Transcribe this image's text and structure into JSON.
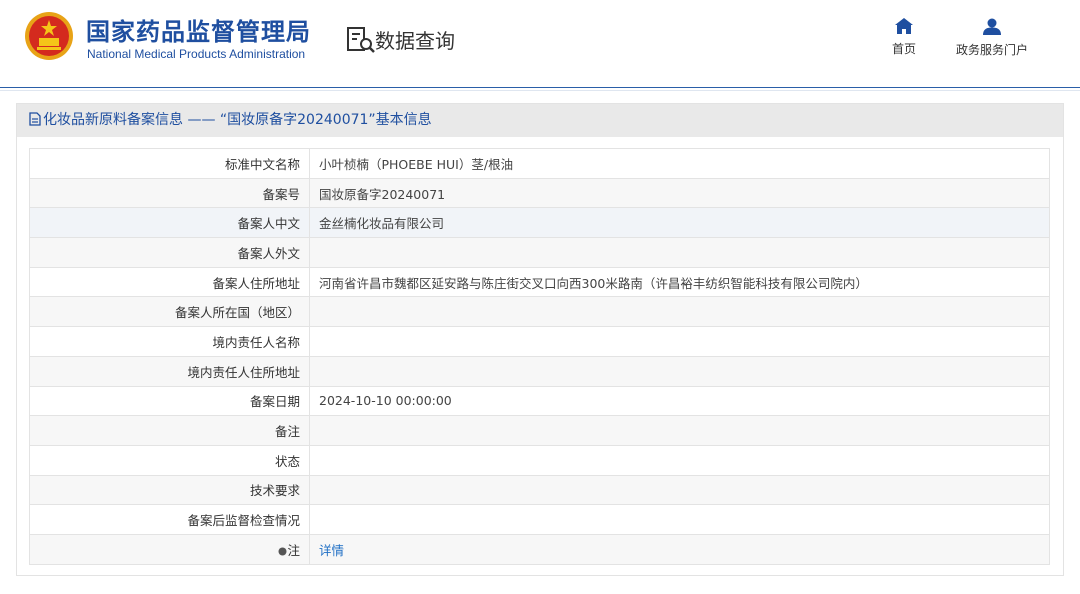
{
  "header": {
    "logo_cn": "国家药品监督管理局",
    "logo_en": "National Medical Products Administration",
    "query_title": "数据查询",
    "nav": [
      {
        "label": "首页",
        "icon": "home-icon"
      },
      {
        "label": "政务服务门户",
        "icon": "user-icon"
      }
    ]
  },
  "panel": {
    "title": "化妆品新原料备案信息 —— “国妆原备字20240071”基本信息",
    "rows": [
      {
        "label": "标准中文名称",
        "value": "小叶桢楠（PHOEBE HUI）茎/根油"
      },
      {
        "label": "备案号",
        "value": "国妆原备字20240071"
      },
      {
        "label": "备案人中文",
        "value": "金丝楠化妆品有限公司"
      },
      {
        "label": "备案人外文",
        "value": ""
      },
      {
        "label": "备案人住所地址",
        "value": "河南省许昌市魏都区延安路与陈庄街交叉口向西300米路南（许昌裕丰纺织智能科技有限公司院内）"
      },
      {
        "label": "备案人所在国（地区）",
        "value": ""
      },
      {
        "label": "境内责任人名称",
        "value": ""
      },
      {
        "label": "境内责任人住所地址",
        "value": ""
      },
      {
        "label": "备案日期",
        "value": "2024-10-10 00:00:00"
      },
      {
        "label": "备注",
        "value": ""
      },
      {
        "label": "状态",
        "value": ""
      },
      {
        "label": "技术要求",
        "value": ""
      },
      {
        "label": "备案后监督检查情况",
        "value": ""
      }
    ],
    "note": {
      "label": "注",
      "link": "详情"
    }
  },
  "colors": {
    "brand_blue": "#1f4fa0",
    "link": "#1f6fc5"
  }
}
